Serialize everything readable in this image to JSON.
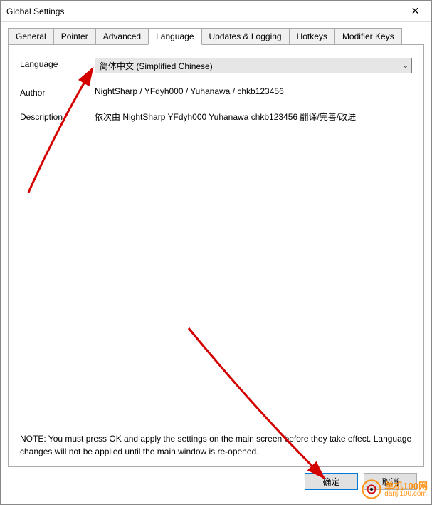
{
  "window": {
    "title": "Global Settings",
    "close_glyph": "✕"
  },
  "tabs": [
    {
      "label": "General"
    },
    {
      "label": "Pointer"
    },
    {
      "label": "Advanced"
    },
    {
      "label": "Language"
    },
    {
      "label": "Updates & Logging"
    },
    {
      "label": "Hotkeys"
    },
    {
      "label": "Modifier Keys"
    }
  ],
  "language_panel": {
    "language_label": "Language",
    "language_value": "简体中文 (Simplified Chinese)",
    "author_label": "Author",
    "author_value": "NightSharp / YFdyh000 / Yuhanawa / chkb123456",
    "description_label": "Description",
    "description_value": "依次由 NightSharp YFdyh000 Yuhanawa chkb123456 翻译/完善/改进",
    "note": "NOTE: You must press OK and apply the settings on the main screen before they take effect. Language changes will not be applied until the main window is re-opened."
  },
  "buttons": {
    "ok": "确定",
    "cancel": "取消"
  },
  "watermark": {
    "line1": "单机100网",
    "line2": "danji100.com"
  }
}
